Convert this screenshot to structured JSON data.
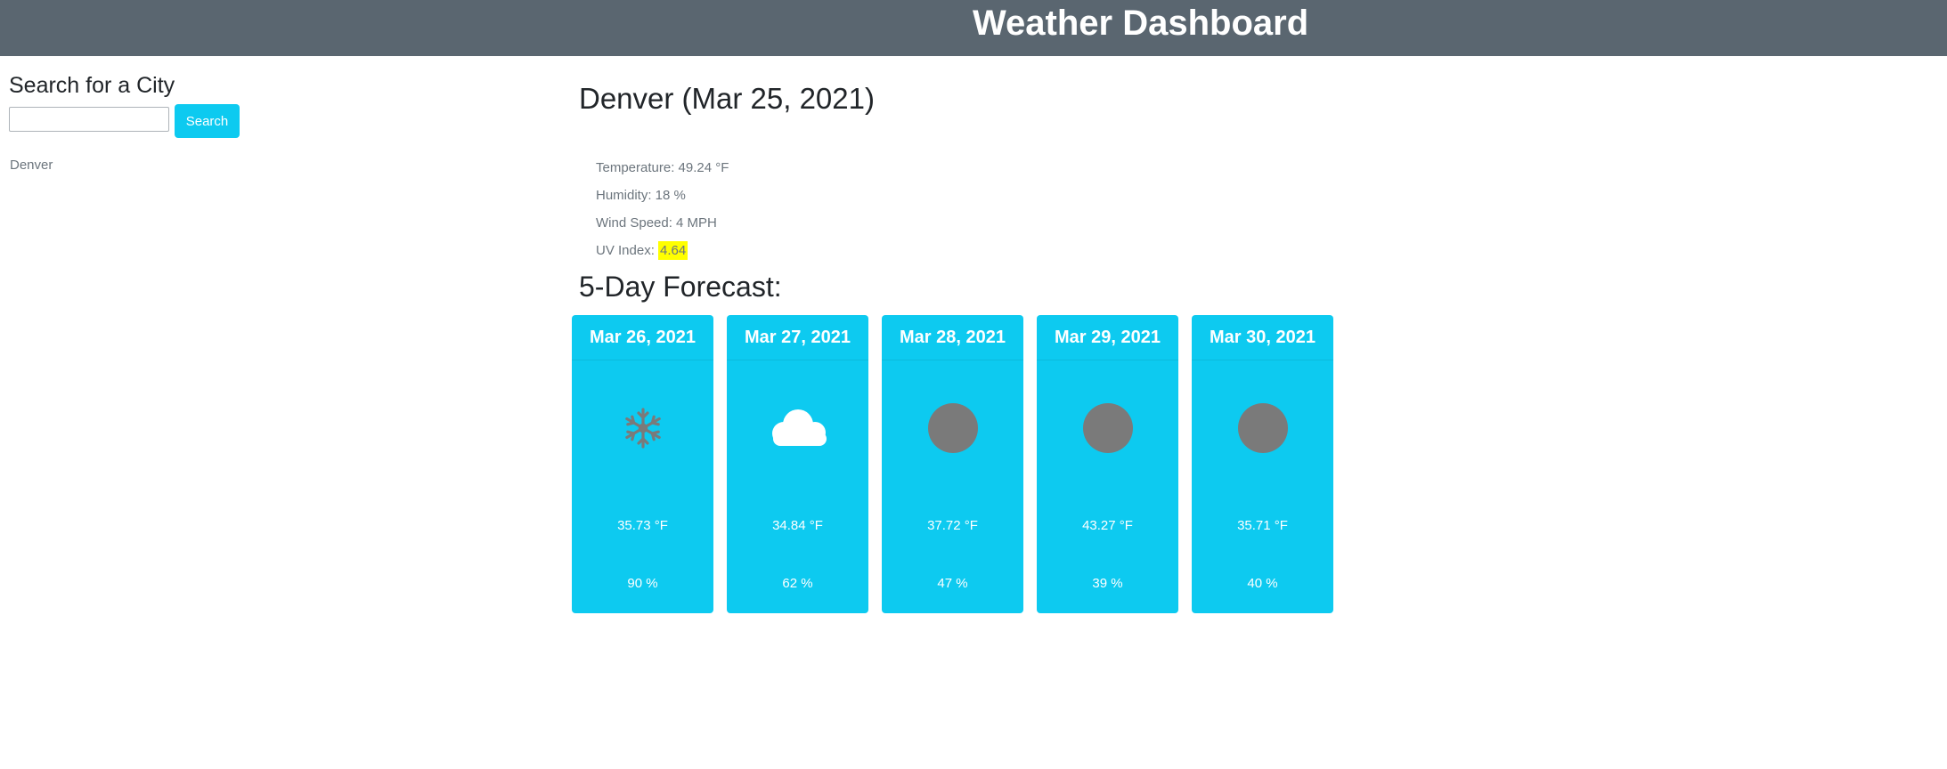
{
  "header": {
    "title": "Weather Dashboard"
  },
  "search": {
    "heading": "Search for a City",
    "input_value": "",
    "button_label": "Search",
    "history": [
      "Denver"
    ]
  },
  "current": {
    "title": "Denver (Mar 25, 2021)",
    "temperature": "Temperature: 49.24 °F",
    "humidity": "Humidity: 18 %",
    "wind": "Wind Speed: 4 MPH",
    "uv_label": "UV Index:",
    "uv_value": "4.64",
    "uv_color": "#ffff00"
  },
  "forecast": {
    "heading": "5-Day Forecast:",
    "accent": "#0dcaf0",
    "days": [
      {
        "date": "Mar 26, 2021",
        "icon": "snowflake-icon",
        "temp": "35.73 °F",
        "humidity": "90 %"
      },
      {
        "date": "Mar 27, 2021",
        "icon": "cloud-icon",
        "temp": "34.84 °F",
        "humidity": "62 %"
      },
      {
        "date": "Mar 28, 2021",
        "icon": "moon-icon",
        "temp": "37.72 °F",
        "humidity": "47 %"
      },
      {
        "date": "Mar 29, 2021",
        "icon": "moon-icon",
        "temp": "43.27 °F",
        "humidity": "39 %"
      },
      {
        "date": "Mar 30, 2021",
        "icon": "moon-icon",
        "temp": "35.71 °F",
        "humidity": "40 %"
      }
    ]
  }
}
